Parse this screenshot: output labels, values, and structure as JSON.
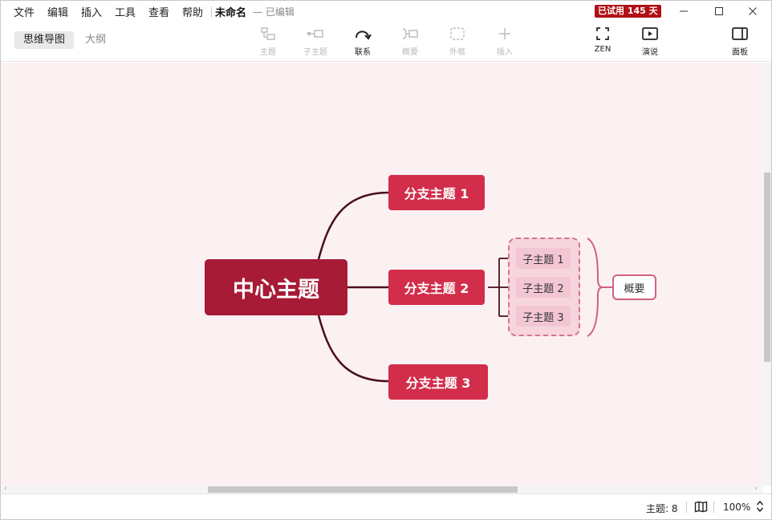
{
  "menu": {
    "items": [
      "文件",
      "编辑",
      "插入",
      "工具",
      "查看",
      "帮助"
    ],
    "doc_title": "未命名",
    "doc_status": "— 已编辑",
    "trial_badge": "已试用 145 天"
  },
  "view_tabs": {
    "mindmap": "思维导图",
    "outline": "大纲"
  },
  "toolbar": {
    "topic": "主题",
    "subtopic": "子主题",
    "relationship": "联系",
    "summary": "概要",
    "boundary": "外框",
    "insert": "插入",
    "zen": "ZEN",
    "present": "演说",
    "panel": "面板"
  },
  "mindmap": {
    "central": "中心主题",
    "branches": [
      "分支主题 1",
      "分支主题 2",
      "分支主题 3"
    ],
    "subtopics": [
      "子主题 1",
      "子主题 2",
      "子主题 3"
    ],
    "summary": "概要"
  },
  "status": {
    "topic_count": "主题: 8",
    "zoom": "100%"
  },
  "colors": {
    "central": "#a71b37",
    "branch": "#d22d4a",
    "connector": "#4a0f1c",
    "canvas": "#fcf1f2",
    "trial_badge": "#b01016"
  }
}
